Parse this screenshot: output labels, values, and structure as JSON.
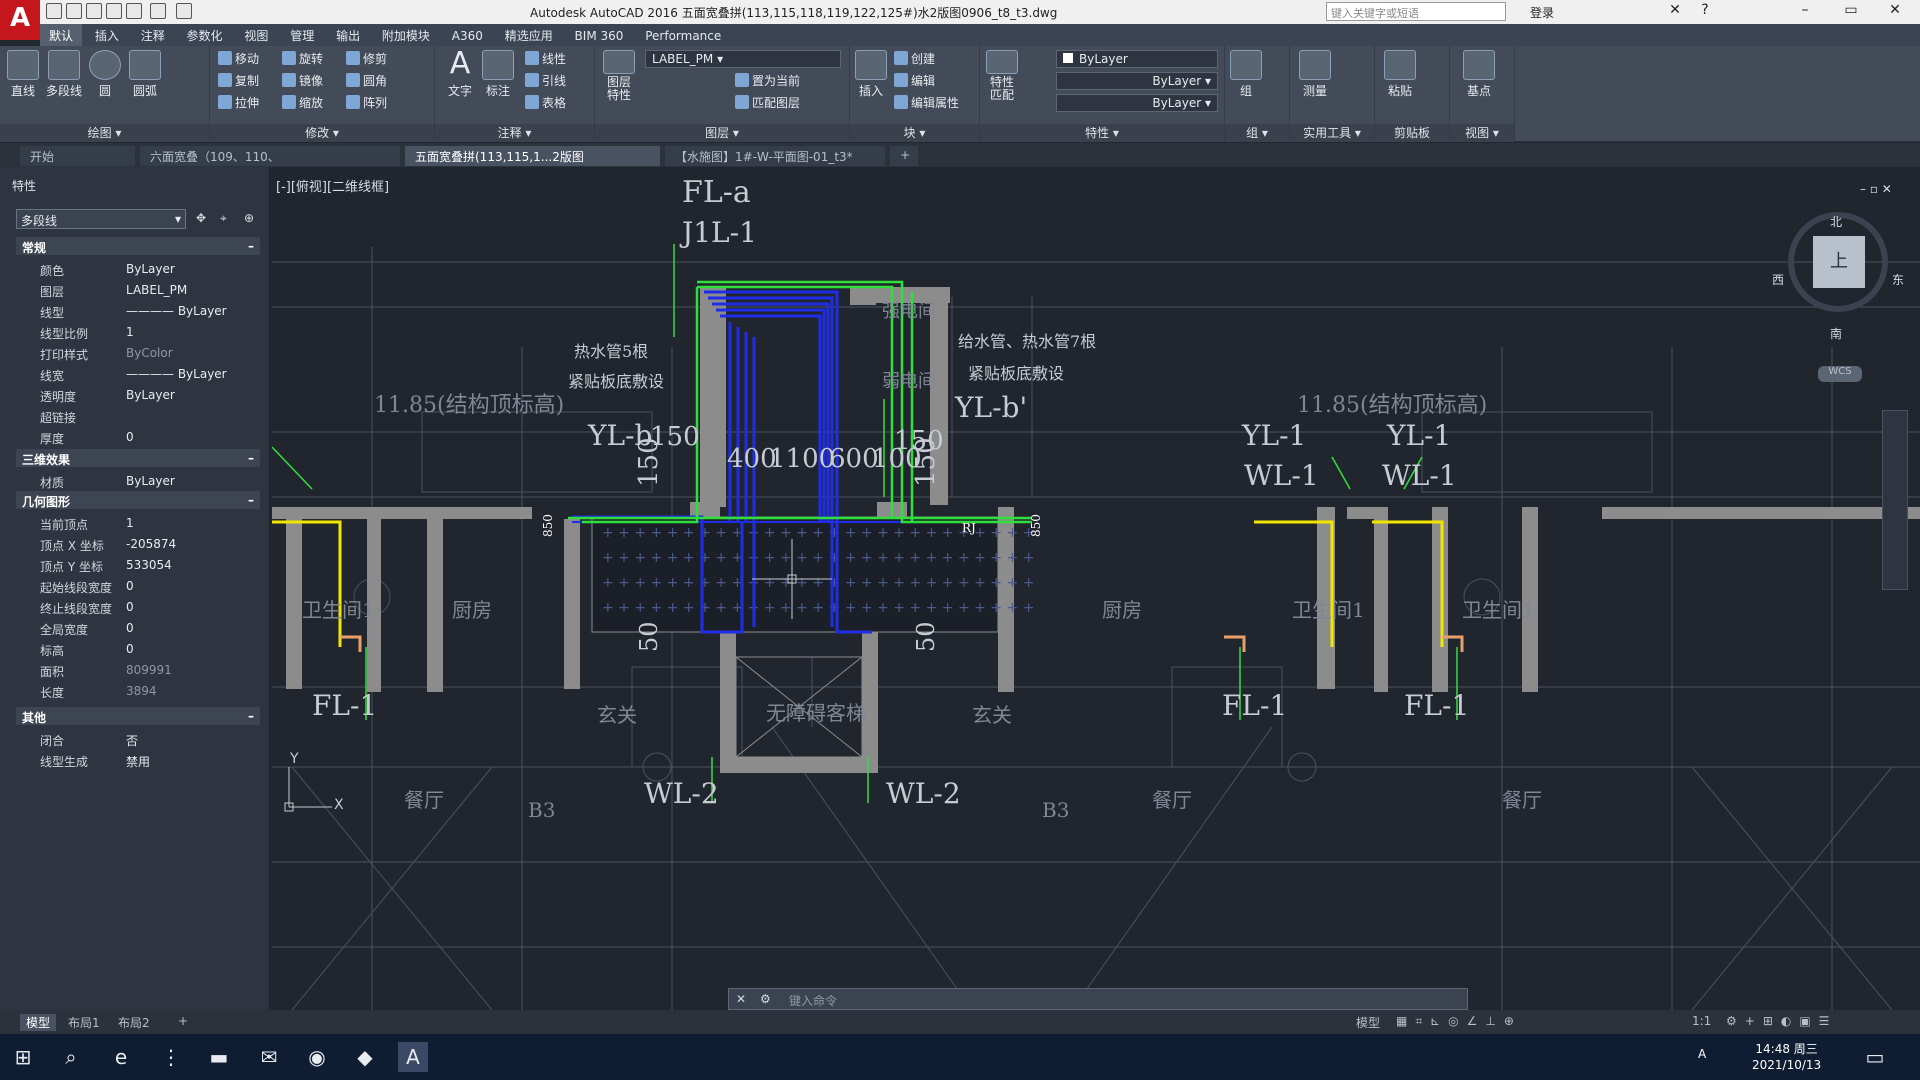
{
  "app": {
    "title": "Autodesk AutoCAD 2016    五面宽叠拼(113,115,118,119,122,125#)水2版图0906_t8_t3.dwg",
    "search_placeholder": "键入关键字或短语",
    "login": "登录",
    "logo": "A"
  },
  "ribbon_tabs": [
    "默认",
    "插入",
    "注释",
    "参数化",
    "视图",
    "管理",
    "输出",
    "附加模块",
    "A360",
    "精选应用",
    "BIM 360",
    "Performance"
  ],
  "ribbon": {
    "draw": {
      "caption": "绘图 ▾",
      "line": "直线",
      "polyline": "多段线",
      "circle": "圆",
      "arc": "圆弧"
    },
    "modify": {
      "caption": "修改 ▾",
      "items": [
        "移动",
        "旋转",
        "修剪",
        "复制",
        "镜像",
        "圆角",
        "拉伸",
        "缩放",
        "阵列"
      ]
    },
    "annotation": {
      "caption": "注释 ▾",
      "text": "文字",
      "dim": "标注",
      "items": [
        "线性",
        "引线",
        "表格"
      ]
    },
    "layers": {
      "caption": "图层 ▾",
      "props": "图层\n特性",
      "current": "LABEL_PM",
      "items": [
        "置为当前",
        "匹配图层"
      ]
    },
    "block": {
      "caption": "块 ▾",
      "insert": "插入",
      "items": [
        "创建",
        "编辑",
        "编辑属性"
      ]
    },
    "properties": {
      "caption": "特性 ▾",
      "match": "特性\n匹配",
      "color": "ByLayer",
      "linetype": "ByLayer",
      "lineweight": "ByLayer"
    },
    "groups": {
      "caption": "组 ▾",
      "label": "组"
    },
    "utilities": {
      "caption": "实用工具 ▾",
      "measure": "测量"
    },
    "clipboard": {
      "caption": "剪贴板",
      "paste": "粘贴"
    },
    "view": {
      "caption": "视图 ▾",
      "base": "基点"
    }
  },
  "doc_tabs": [
    "开始",
    "六面宽叠（109、110、1...0906_t8_t3_t3*",
    "五面宽叠拼(113,115,1...2版图0906_t8_t3*",
    "【水施图】1#-W-平面图-01_t3*",
    "+"
  ],
  "properties_panel": {
    "title": "特性",
    "selected": "多段线",
    "sections": {
      "general": "常规",
      "3d": "三维效果",
      "geometry": "几何图形",
      "misc": "其他"
    },
    "general": [
      [
        "颜色",
        "ByLayer"
      ],
      [
        "图层",
        "LABEL_PM"
      ],
      [
        "线型",
        "———— ByLayer"
      ],
      [
        "线型比例",
        "1"
      ],
      [
        "打印样式",
        "ByColor"
      ],
      [
        "线宽",
        "———— ByLayer"
      ],
      [
        "透明度",
        "ByLayer"
      ],
      [
        "超链接",
        ""
      ],
      [
        "厚度",
        "0"
      ]
    ],
    "3d": [
      [
        "材质",
        "ByLayer"
      ]
    ],
    "geometry": [
      [
        "当前顶点",
        "1"
      ],
      [
        "顶点 X 坐标",
        "-205874"
      ],
      [
        "顶点 Y 坐标",
        "533054"
      ],
      [
        "起始线段宽度",
        "0"
      ],
      [
        "终止线段宽度",
        "0"
      ],
      [
        "全局宽度",
        "0"
      ],
      [
        "标高",
        "0"
      ],
      [
        "面积",
        "809991"
      ],
      [
        "长度",
        "3894"
      ]
    ],
    "misc": [
      [
        "闭合",
        "否"
      ],
      [
        "线型生成",
        "禁用"
      ]
    ]
  },
  "viewport": {
    "label": "[-][俯视][二维线框]",
    "compass": {
      "n": "北",
      "s": "南",
      "e": "东",
      "w": "西",
      "center": "上",
      "wcs": "WCS"
    }
  },
  "drawing_labels": [
    "FL-a",
    "J1L-1",
    "热水管5根",
    "紧贴板底敷设",
    "给水管、热水管7根",
    "紧贴板底敷设",
    "YL-b'",
    "YL-b",
    "150",
    "150",
    "150",
    "150",
    "400",
    "1100",
    "600",
    "100",
    "YL-1",
    "WL-1",
    "YL-1",
    "WL-1",
    "11.85(结构顶标高)",
    "11.85(结构顶标高)",
    "FL-1",
    "FL-1",
    "FL-1",
    "WL-2",
    "WL-2",
    "50",
    "50",
    "厨房",
    "厨房",
    "卫生间1",
    "卫生间1",
    "卫生间1",
    "玄关",
    "玄关",
    "无障碍客梯",
    "餐厅",
    "餐厅",
    "餐厅",
    "B3",
    "B3",
    "强电间",
    "弱电间",
    "RJ",
    "850",
    "850"
  ],
  "command_line": {
    "placeholder": "键入命令"
  },
  "layout_tabs": [
    "模型",
    "布局1",
    "布局2",
    "+"
  ],
  "status": {
    "model": "模型",
    "scale": "1:1"
  },
  "taskbar": {
    "time": "14:48 周三",
    "date": "2021/10/13",
    "lang": "A"
  },
  "colors": {
    "accent": "#c4161c",
    "ribbon_bg": "#434b58",
    "canvas_bg": "#21262e",
    "pipe_green": "#2fe03a",
    "pipe_blue": "#1f2ee6",
    "pipe_yellow": "#f2e600",
    "wall": "#8c8c8c"
  }
}
